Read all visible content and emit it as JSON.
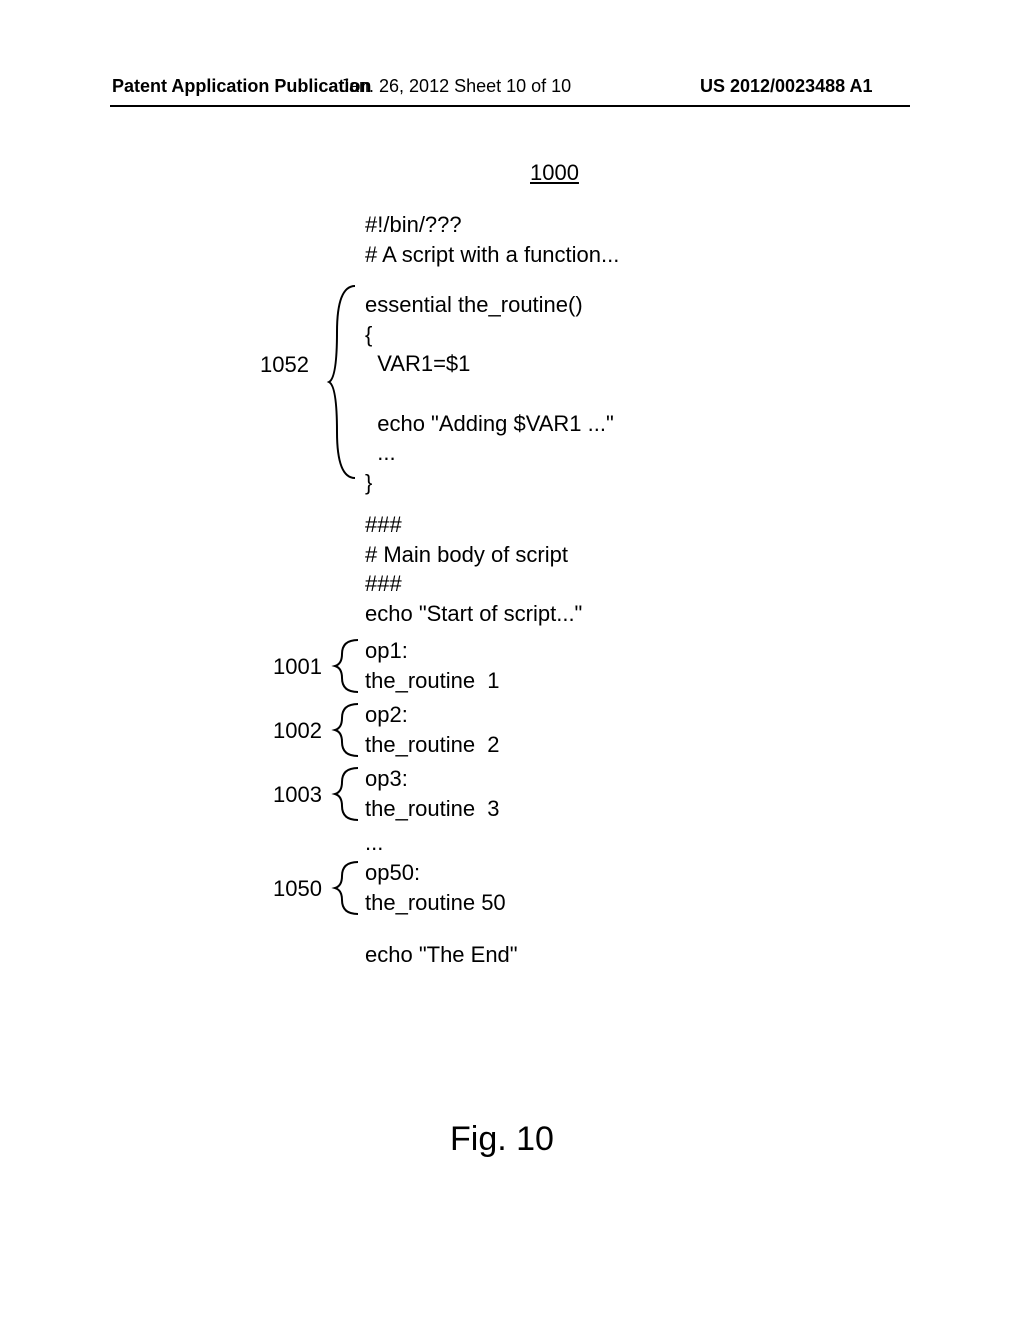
{
  "header": {
    "left": "Patent Application Publication",
    "center": "Jan. 26, 2012  Sheet 10 of 10",
    "right": "US 2012/0023488 A1"
  },
  "figure_number": "1000",
  "code": {
    "shebang": "#!/bin/???\n# A script with a function...",
    "routine": "essential the_routine()\n{\n  VAR1=$1\n\n  echo \"Adding $VAR1 ...\"\n  ...\n}",
    "main": "###\n# Main body of script\n###\necho \"Start of script...\"",
    "op1": "op1:\nthe_routine  1",
    "op2": "op2:\nthe_routine  2",
    "op3": "op3:\nthe_routine  3",
    "ellipsis": "...",
    "op50": "op50:\nthe_routine 50",
    "end": "echo \"The End\""
  },
  "labels": {
    "l1052": "1052",
    "l1001": "1001",
    "l1002": "1002",
    "l1003": "1003",
    "l1050": "1050"
  },
  "caption": "Fig.  10"
}
